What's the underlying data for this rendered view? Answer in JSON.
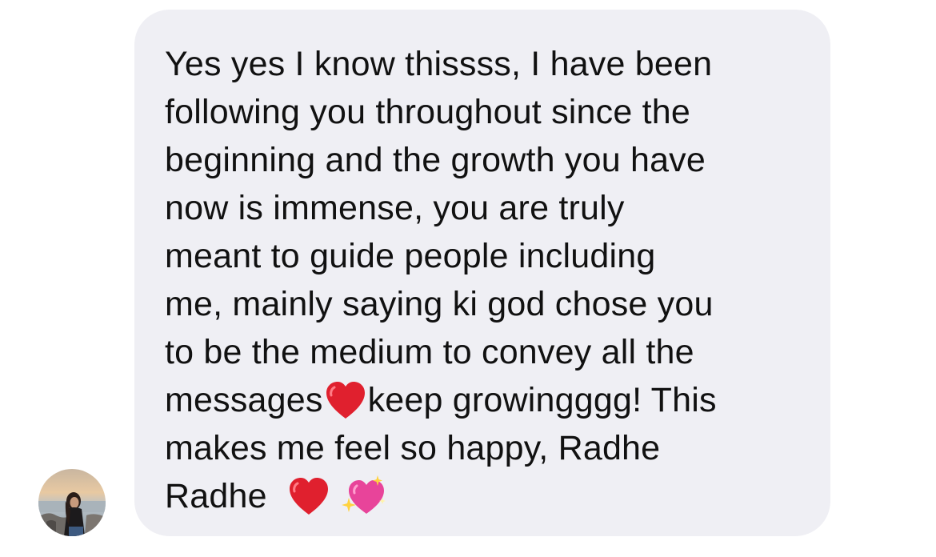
{
  "message": {
    "lines": [
      "Yes yes I know thissss, I have been",
      "following you throughout since the",
      "beginning and the growth you have",
      "now is immense, you are truly",
      "meant to guide people including",
      "me, mainly saying ki god chose you",
      "to be the medium to convey all the"
    ],
    "line8_before": "messages",
    "line8_after": "keep growingggg! This",
    "line9": "makes me feel so happy, Radhe",
    "line10": "Radhe"
  },
  "icons": {
    "heart": "red-heart-emoji",
    "sparkle_heart": "sparkling-heart-emoji"
  },
  "colors": {
    "bubble_background": "#efeff4",
    "text": "#111111",
    "heart_red": "#e0202e",
    "sparkle_heart_pink": "#e8449a"
  }
}
